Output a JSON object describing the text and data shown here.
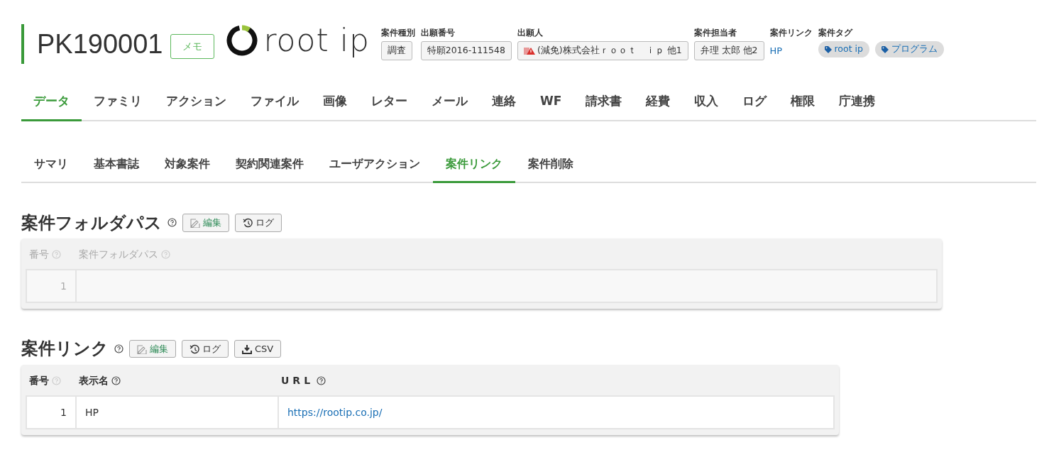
{
  "header": {
    "case_id": "PK190001",
    "memo_button": "メモ",
    "logo": "root ip",
    "fields": [
      {
        "kind": "box",
        "label": "案件種別",
        "values": [
          "調査"
        ]
      },
      {
        "kind": "box",
        "label": "出願番号",
        "values": [
          "特願2016-111548"
        ]
      },
      {
        "kind": "box",
        "label": "出願人",
        "values": [
          "(減免)株式会社ｒｏｏｔ　ｉｐ 他1"
        ],
        "warning": true
      },
      {
        "kind": "box",
        "label": "案件担当者",
        "values": [
          "弁理 太郎 他2"
        ]
      },
      {
        "kind": "link",
        "label": "案件リンク",
        "values": [
          "HP"
        ]
      },
      {
        "kind": "tags",
        "label": "案件タグ",
        "values": [
          "root ip",
          "プログラム"
        ]
      }
    ]
  },
  "main_tabs": [
    {
      "label": "データ",
      "selected": true
    },
    {
      "label": "ファミリ",
      "selected": false
    },
    {
      "label": "アクション",
      "selected": false
    },
    {
      "label": "ファイル",
      "selected": false
    },
    {
      "label": "画像",
      "selected": false
    },
    {
      "label": "レター",
      "selected": false
    },
    {
      "label": "メール",
      "selected": false
    },
    {
      "label": "連絡",
      "selected": false
    },
    {
      "label": "WF",
      "selected": false
    },
    {
      "label": "請求書",
      "selected": false
    },
    {
      "label": "経費",
      "selected": false
    },
    {
      "label": "収入",
      "selected": false
    },
    {
      "label": "ログ",
      "selected": false
    },
    {
      "label": "権限",
      "selected": false
    },
    {
      "label": "庁連携",
      "selected": false
    }
  ],
  "sub_tabs": [
    {
      "label": "サマリ",
      "selected": false
    },
    {
      "label": "基本書誌",
      "selected": false
    },
    {
      "label": "対象案件",
      "selected": false
    },
    {
      "label": "契約関連案件",
      "selected": false
    },
    {
      "label": "ユーザアクション",
      "selected": false
    },
    {
      "label": "案件リンク",
      "selected": true
    },
    {
      "label": "案件削除",
      "selected": false
    }
  ],
  "sections": [
    {
      "title": "案件フォルダパス",
      "disabled": true,
      "buttons": [
        {
          "kind": "edit",
          "label": "編集"
        },
        {
          "kind": "log",
          "label": "ログ"
        }
      ],
      "columns": [
        "番号",
        "案件フォルダパス"
      ],
      "rows": [
        [
          "1",
          ""
        ]
      ]
    },
    {
      "title": "案件リンク",
      "disabled": false,
      "buttons": [
        {
          "kind": "edit",
          "label": "編集"
        },
        {
          "kind": "log",
          "label": "ログ"
        },
        {
          "kind": "csv",
          "label": "CSV"
        }
      ],
      "columns": [
        "番号",
        "表示名",
        "URL"
      ],
      "rows": [
        [
          "1",
          "HP",
          "https://rootip.co.jp/"
        ]
      ]
    }
  ]
}
